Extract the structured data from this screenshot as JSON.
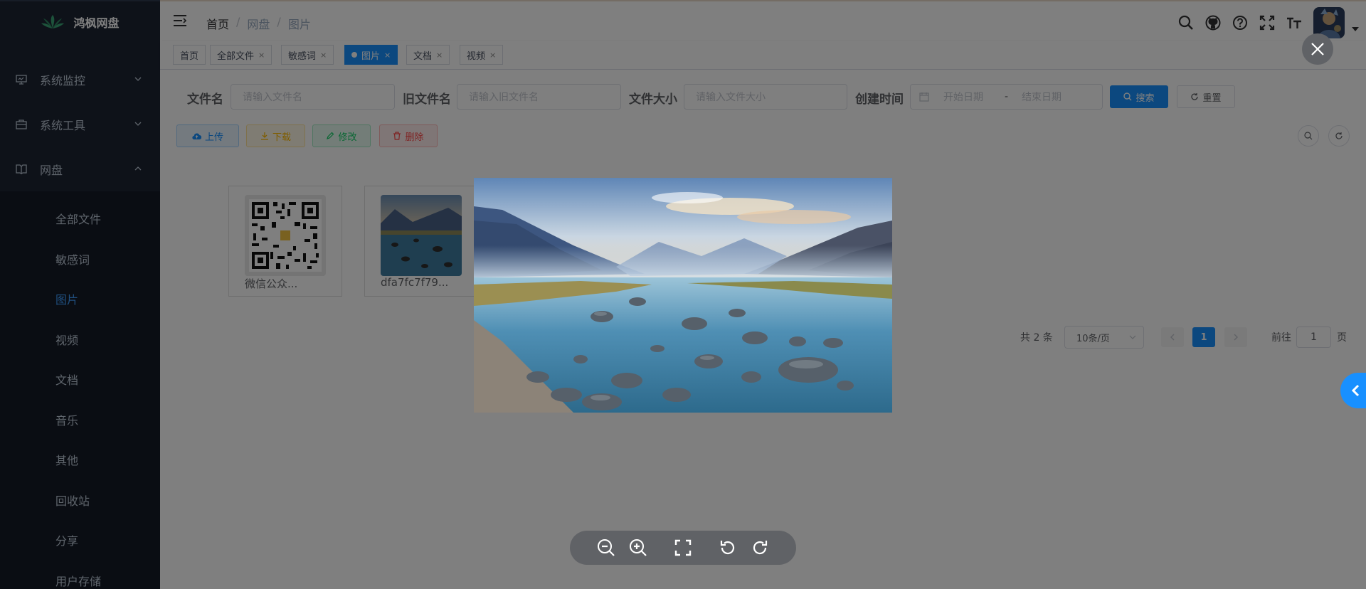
{
  "app": {
    "title": "鸿枫网盘"
  },
  "sidebar": {
    "menus": [
      {
        "label": "系统监控",
        "icon": "monitor-icon"
      },
      {
        "label": "系统工具",
        "icon": "toolbox-icon"
      },
      {
        "label": "网盘",
        "icon": "book-icon"
      }
    ],
    "submenu": [
      {
        "label": "全部文件"
      },
      {
        "label": "敏感词"
      },
      {
        "label": "图片"
      },
      {
        "label": "视频"
      },
      {
        "label": "文档"
      },
      {
        "label": "音乐"
      },
      {
        "label": "其他"
      },
      {
        "label": "回收站"
      },
      {
        "label": "分享"
      },
      {
        "label": "用户存储"
      }
    ],
    "active_item": "图片"
  },
  "breadcrumb": {
    "home": "首页",
    "sep": "/",
    "parent": "网盘",
    "current": "图片"
  },
  "tags": [
    {
      "label": "首页"
    },
    {
      "label": "全部文件",
      "close": "×"
    },
    {
      "label": "敏感词",
      "close": "×"
    },
    {
      "label": "图片",
      "close": "×",
      "active": true
    },
    {
      "label": "文档",
      "close": "×"
    },
    {
      "label": "视频",
      "close": "×"
    }
  ],
  "search": {
    "filename_label": "文件名",
    "filename_placeholder": "请输入文件名",
    "oldname_label": "旧文件名",
    "oldname_placeholder": "请输入旧文件名",
    "size_label": "文件大小",
    "size_placeholder": "请输入文件大小",
    "created_label": "创建时间",
    "start_placeholder": "开始日期",
    "range_sep": "-",
    "end_placeholder": "结束日期",
    "search_button": "搜索",
    "reset_button": "重置"
  },
  "toolbar": {
    "upload": "上传",
    "download": "下载",
    "edit": "修改",
    "delete": "删除"
  },
  "files": [
    {
      "name": "微信公众..."
    },
    {
      "name": "dfa7fc7f79..."
    }
  ],
  "pagination": {
    "total": "共 2 条",
    "page_size": "10条/页",
    "current_page": "1",
    "goto_label": "前往",
    "goto_value": "1",
    "page_unit": "页"
  },
  "colors": {
    "sidebar_bg": "#1d2433",
    "accent": "#1890ff",
    "overlay": "rgba(0,0,0,0.5)"
  }
}
